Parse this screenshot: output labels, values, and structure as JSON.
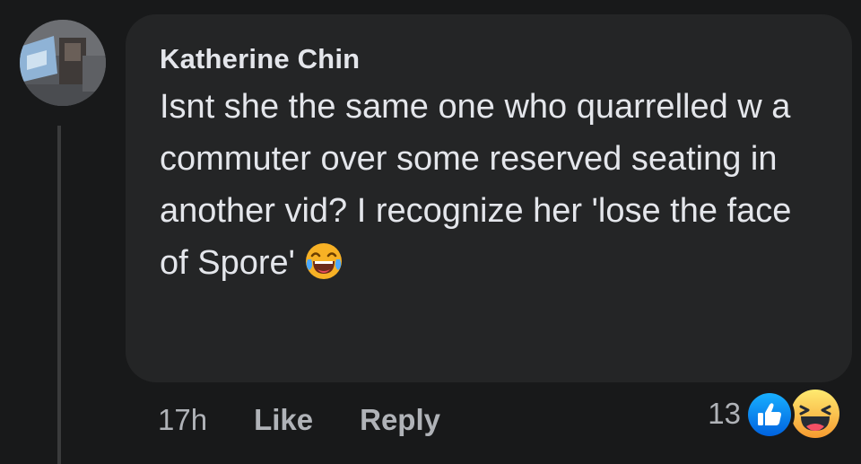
{
  "comment": {
    "author": "Katherine Chin",
    "text": "Isnt she the same one who quarrelled w a commuter over some reserved seating in another vid? I recognize her 'lose the face of Spore'",
    "inline_emoji": "laughing-with-tears-icon"
  },
  "actions": {
    "time": "17h",
    "like_label": "Like",
    "reply_label": "Reply"
  },
  "reactions": {
    "count": "13",
    "icons": [
      "like-reaction-icon",
      "haha-reaction-icon"
    ]
  },
  "colors": {
    "background": "#18191a",
    "bubble": "#242526",
    "primary_text": "#e4e6eb",
    "secondary_text": "#b0b3b8",
    "like_blue": "#1877f2",
    "haha_yellow": "#f7b125"
  }
}
